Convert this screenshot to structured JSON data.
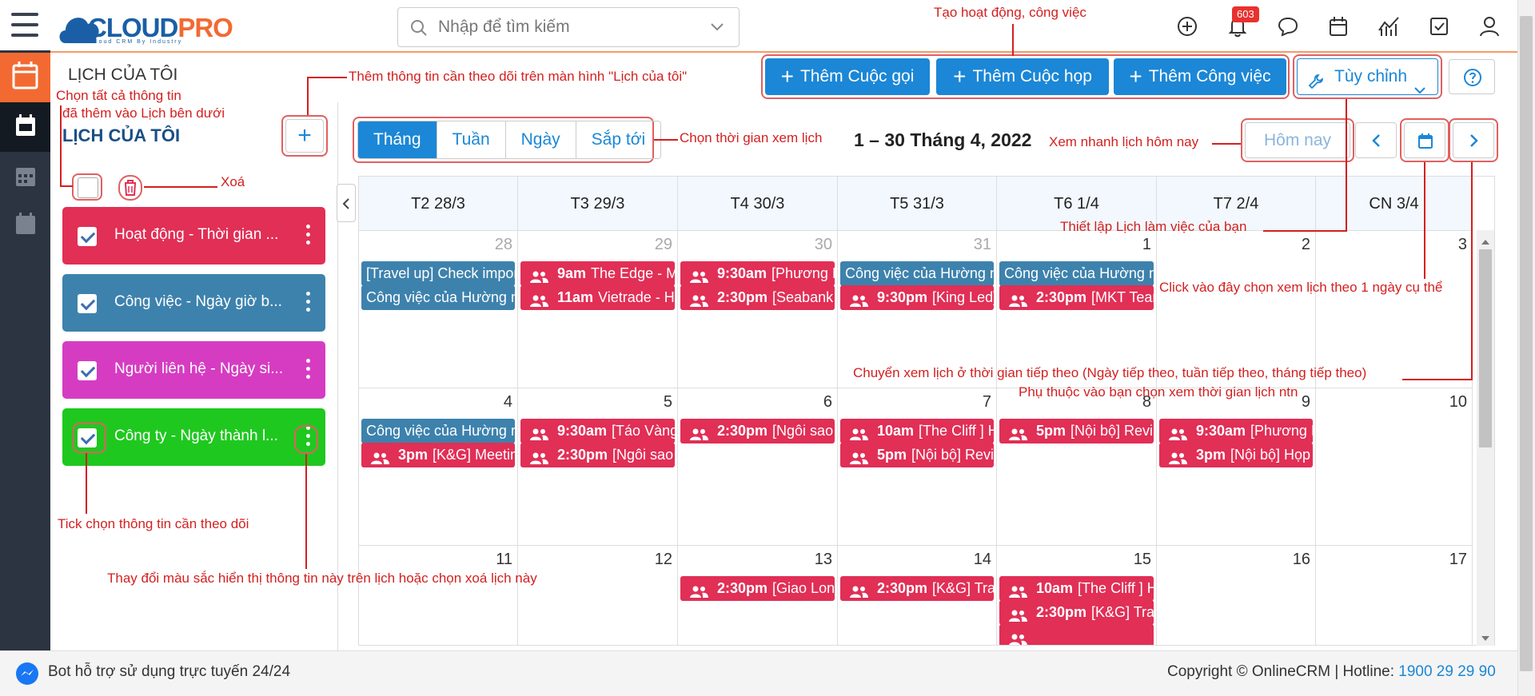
{
  "header": {
    "logo_main": "CLOUD",
    "logo_accent": "PRO",
    "logo_tagline": "Cloud CRM By Industry",
    "search_placeholder": "Nhập để tìm kiếm",
    "notification_count": "603"
  },
  "page": {
    "title": "LỊCH CỦA TÔI"
  },
  "actions": {
    "add_call": "Thêm Cuộc gọi",
    "add_meeting": "Thêm Cuộc họp",
    "add_task": "Thêm Công việc",
    "customize": "Tùy chỉnh"
  },
  "sidebar": {
    "title": "LỊCH CỦA TÔI",
    "add_label": "+",
    "items": [
      {
        "label": "Hoạt động - Thời gian ...",
        "color": "#e12f56"
      },
      {
        "label": "Công việc - Ngày giờ b...",
        "color": "#3d82ad"
      },
      {
        "label": "Người liên hệ - Ngày si...",
        "color": "#d63cc2"
      },
      {
        "label": "Công ty - Ngày thành l...",
        "color": "#1fc81f"
      }
    ]
  },
  "view": {
    "tabs": [
      "Tháng",
      "Tuần",
      "Ngày",
      "Sắp tới"
    ],
    "active_tab": "Tháng",
    "date_range": "1 – 30 Tháng 4, 2022",
    "today_label": "Hôm nay"
  },
  "calendar": {
    "day_headers": [
      "T2 28/3",
      "T3 29/3",
      "T4 30/3",
      "T5 31/3",
      "T6 1/4",
      "T7 2/4",
      "CN 3/4"
    ],
    "weeks": [
      {
        "days": [
          {
            "num": "28",
            "dim": true,
            "events": [
              {
                "type": "blue",
                "text": "[Travel up] Check impor"
              },
              {
                "type": "blue",
                "text": "Công việc của Hường n"
              }
            ]
          },
          {
            "num": "29",
            "dim": true,
            "events": [
              {
                "type": "red",
                "time": "9am",
                "text": "The Edge - M"
              },
              {
                "type": "red",
                "time": "11am",
                "text": "Vietrade - H"
              }
            ]
          },
          {
            "num": "30",
            "dim": true,
            "events": [
              {
                "type": "red",
                "time": "9:30am",
                "text": "[Phương N"
              },
              {
                "type": "red",
                "time": "2:30pm",
                "text": "[Seabank"
              }
            ]
          },
          {
            "num": "31",
            "dim": true,
            "events": [
              {
                "type": "blue",
                "text": "Công việc của Hường n"
              },
              {
                "type": "red",
                "time": "9:30pm",
                "text": "[King Led]"
              }
            ]
          },
          {
            "num": "1",
            "dim": false,
            "events": [
              {
                "type": "blue",
                "text": "Công việc của Hường n"
              },
              {
                "type": "red",
                "time": "2:30pm",
                "text": "[MKT Tear"
              }
            ]
          },
          {
            "num": "2",
            "dim": false,
            "events": []
          },
          {
            "num": "3",
            "dim": false,
            "events": []
          }
        ]
      },
      {
        "days": [
          {
            "num": "4",
            "dim": false,
            "events": [
              {
                "type": "blue",
                "text": "Công việc của Hường n"
              },
              {
                "type": "red",
                "time": "3pm",
                "text": "[K&G] Meetin"
              }
            ]
          },
          {
            "num": "5",
            "dim": false,
            "events": [
              {
                "type": "red",
                "time": "9:30am",
                "text": "[Táo Vàng"
              },
              {
                "type": "red",
                "time": "2:30pm",
                "text": "[Ngôi sao"
              }
            ]
          },
          {
            "num": "6",
            "dim": false,
            "events": [
              {
                "type": "red",
                "time": "2:30pm",
                "text": "[Ngôi sao"
              }
            ]
          },
          {
            "num": "7",
            "dim": false,
            "events": [
              {
                "type": "red",
                "time": "10am",
                "text": "[The Cliff ] H"
              },
              {
                "type": "red",
                "time": "5pm",
                "text": "[Nội bộ] Revi"
              }
            ]
          },
          {
            "num": "8",
            "dim": false,
            "events": [
              {
                "type": "red",
                "time": "5pm",
                "text": "[Nội bộ] Revi"
              }
            ]
          },
          {
            "num": "9",
            "dim": false,
            "events": [
              {
                "type": "red",
                "time": "9:30am",
                "text": "[Phương N"
              },
              {
                "type": "red",
                "time": "3pm",
                "text": "[Nội bộ] Họp"
              }
            ]
          },
          {
            "num": "10",
            "dim": false,
            "events": []
          }
        ]
      },
      {
        "days": [
          {
            "num": "11",
            "dim": false,
            "events": []
          },
          {
            "num": "12",
            "dim": false,
            "events": []
          },
          {
            "num": "13",
            "dim": false,
            "events": [
              {
                "type": "red",
                "time": "2:30pm",
                "text": "[Giao Lon"
              }
            ]
          },
          {
            "num": "14",
            "dim": false,
            "events": [
              {
                "type": "red",
                "time": "2:30pm",
                "text": "[K&G] Tra"
              }
            ]
          },
          {
            "num": "15",
            "dim": false,
            "events": [
              {
                "type": "red",
                "time": "10am",
                "text": "[The Cliff ] H"
              },
              {
                "type": "red",
                "time": "2:30pm",
                "text": "[K&G] Tra"
              },
              {
                "type": "red",
                "time": "",
                "text": ""
              }
            ]
          },
          {
            "num": "16",
            "dim": false,
            "events": []
          },
          {
            "num": "17",
            "dim": false,
            "events": []
          }
        ]
      }
    ]
  },
  "annotations": {
    "create_activity": "Tạo hoạt động, công việc",
    "add_info": "Thêm thông tin cần theo dõi trên màn hình \"Lịch của tôi\"",
    "select_all_1": "Chọn tất cả thông tin",
    "select_all_2": "đã thêm vào Lịch bên dưới",
    "delete": "Xoá",
    "choose_time": "Chọn thời gian xem lịch",
    "view_today": "Xem nhanh lịch hôm nay",
    "setup_calendar": "Thiết lập Lịch làm việc của bạn",
    "pick_day": "Click vào đây chọn xem lịch theo 1 ngày cụ thể",
    "next_1": "Chuyển xem lịch ở thời gian tiếp theo (Ngày tiếp theo, tuần tiếp theo, tháng tiếp theo)",
    "next_2": "Phụ thuộc vào bạn chọn xem thời gian lịch ntn",
    "tick": "Tick chọn thông tin cần theo dõi",
    "change_color": "Thay đổi màu sắc hiển thị thông tin này trên lịch hoặc chọn xoá lịch này"
  },
  "footer": {
    "bot": "Bot hỗ trợ sử dụng trực tuyến 24/24",
    "copyright": "Copyright © OnlineCRM | Hotline: ",
    "hotline": "1900 29 29 90"
  }
}
